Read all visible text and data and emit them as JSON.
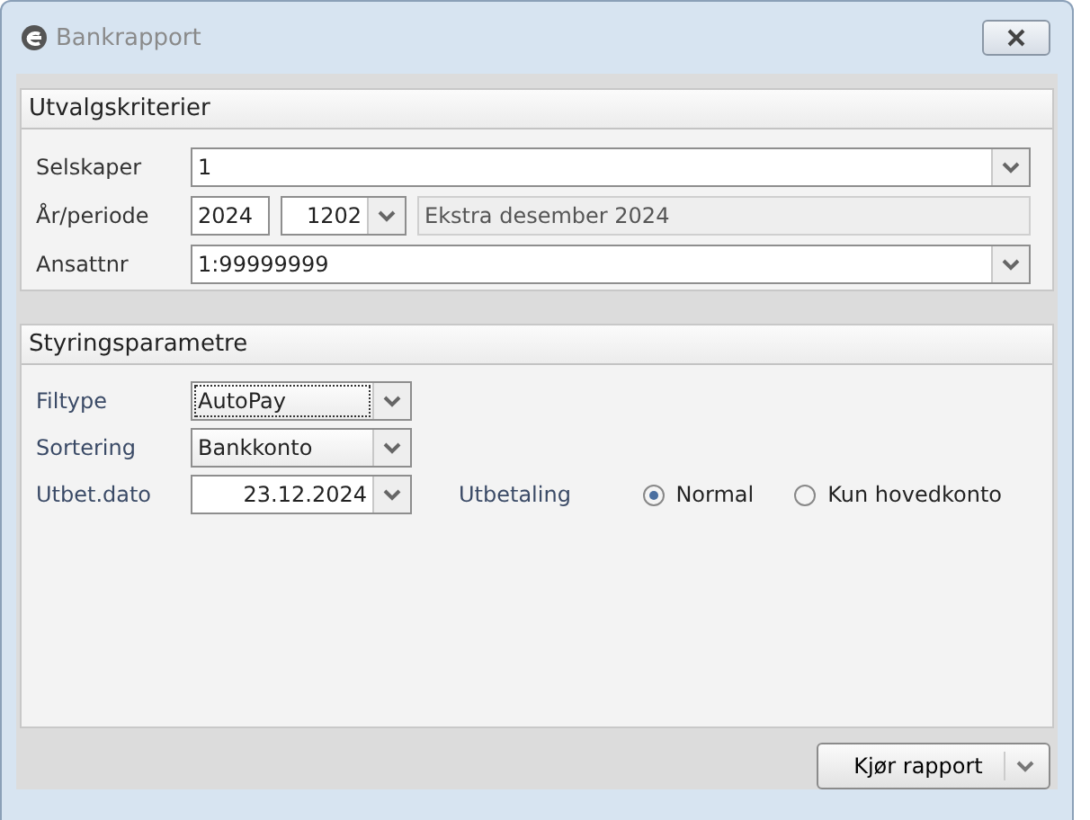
{
  "window": {
    "title": "Bankrapport"
  },
  "selection": {
    "title": "Utvalgskriterier",
    "company": {
      "label": "Selskaper",
      "value": "1"
    },
    "period": {
      "label": "År/periode",
      "year": "2024",
      "period": "1202",
      "description": "Ekstra desember 2024"
    },
    "employees": {
      "label": "Ansattnr",
      "value": "1:99999999"
    }
  },
  "parameters": {
    "title": "Styringsparametre",
    "fields": [
      {
        "label": "Filtype",
        "value": "AutoPay",
        "focused": true,
        "kind": "dropdown"
      },
      {
        "label": "Sortering",
        "value": "Bankkonto",
        "focused": false,
        "kind": "dropdown"
      },
      {
        "label": "Utbet.dato",
        "value": "23.12.2024",
        "focused": false,
        "kind": "date"
      }
    ],
    "payment": {
      "label": "Utbetaling",
      "options": [
        {
          "label": "Normal",
          "selected": true
        },
        {
          "label": "Kun hovedkonto",
          "selected": false
        }
      ]
    }
  },
  "run_button": {
    "label": "Kjør rapport"
  }
}
